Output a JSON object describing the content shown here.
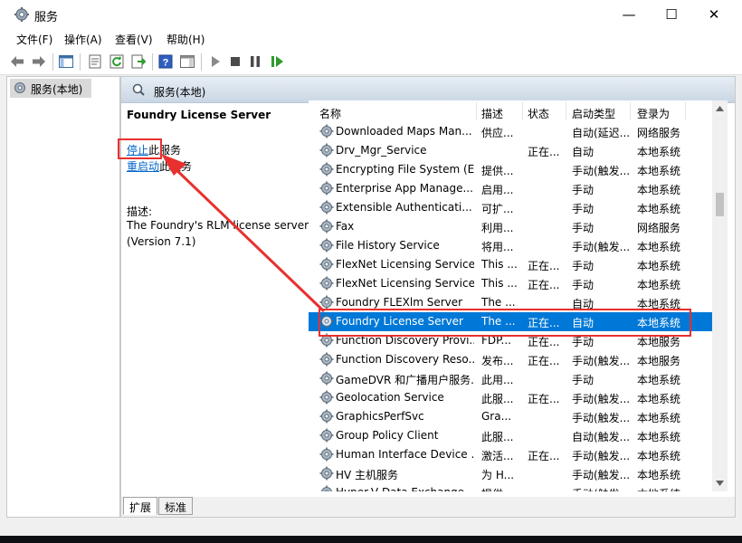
{
  "window": {
    "title": "服务",
    "minimize": "—",
    "maximize": "☐",
    "close": "✕"
  },
  "menu": [
    "文件(F)",
    "操作(A)",
    "查看(V)",
    "帮助(H)"
  ],
  "toolbar": {
    "icons": [
      "back-arrow-icon",
      "forward-arrow-icon",
      "show-hide-console-tree-icon",
      "properties-icon",
      "refresh-icon",
      "export-list-icon",
      "help-icon",
      "show-hide-action-pane-icon",
      "start-service-icon",
      "stop-service-icon",
      "pause-service-icon",
      "restart-service-icon"
    ]
  },
  "tree": {
    "items": [
      {
        "label": "服务(本地)"
      }
    ]
  },
  "main": {
    "header": "服务(本地)",
    "detail": {
      "service_name": "Foundry License Server",
      "stop_link": "停止",
      "stop_suffix": "此服务",
      "restart_link": "重启动",
      "restart_suffix": "此服务",
      "desc_label": "描述:",
      "desc_text_1": "The Foundry's RLM license server",
      "desc_text_2": "(Version 7.1)"
    },
    "columns": [
      "名称",
      "描述",
      "状态",
      "启动类型",
      "登录为"
    ],
    "rows": [
      {
        "name": "Downloaded Maps Man...",
        "desc": "供应...",
        "status": "",
        "startup": "自动(延迟...",
        "logon": "网络服务"
      },
      {
        "name": "Drv_Mgr_Service",
        "desc": "",
        "status": "正在...",
        "startup": "自动",
        "logon": "本地系统"
      },
      {
        "name": "Encrypting File System (E...",
        "desc": "提供...",
        "status": "",
        "startup": "手动(触发...",
        "logon": "本地系统"
      },
      {
        "name": "Enterprise App Manage...",
        "desc": "启用...",
        "status": "",
        "startup": "手动",
        "logon": "本地系统"
      },
      {
        "name": "Extensible Authenticati...",
        "desc": "可扩...",
        "status": "",
        "startup": "手动",
        "logon": "本地系统"
      },
      {
        "name": "Fax",
        "desc": "利用...",
        "status": "",
        "startup": "手动",
        "logon": "网络服务"
      },
      {
        "name": "File History Service",
        "desc": "将用...",
        "status": "",
        "startup": "手动(触发...",
        "logon": "本地系统"
      },
      {
        "name": "FlexNet Licensing Service",
        "desc": "This ...",
        "status": "正在...",
        "startup": "手动",
        "logon": "本地系统"
      },
      {
        "name": "FlexNet Licensing Service...",
        "desc": "This ...",
        "status": "正在...",
        "startup": "手动",
        "logon": "本地系统"
      },
      {
        "name": "Foundry FLEXlm Server",
        "desc": "The ...",
        "status": "",
        "startup": "自动",
        "logon": "本地系统"
      },
      {
        "name": "Foundry License Server",
        "desc": "The ...",
        "status": "正在...",
        "startup": "自动",
        "logon": "本地系统",
        "selected": true
      },
      {
        "name": "Function Discovery Provi...",
        "desc": "FDP...",
        "status": "正在...",
        "startup": "手动",
        "logon": "本地服务"
      },
      {
        "name": "Function Discovery Reso...",
        "desc": "发布...",
        "status": "正在...",
        "startup": "手动(触发...",
        "logon": "本地服务"
      },
      {
        "name": "GameDVR 和广播用户服务...",
        "desc": "此用...",
        "status": "",
        "startup": "手动",
        "logon": "本地系统"
      },
      {
        "name": "Geolocation Service",
        "desc": "此服...",
        "status": "正在...",
        "startup": "手动(触发...",
        "logon": "本地系统"
      },
      {
        "name": "GraphicsPerfSvc",
        "desc": "Gra...",
        "status": "",
        "startup": "手动(触发...",
        "logon": "本地系统"
      },
      {
        "name": "Group Policy Client",
        "desc": "此服...",
        "status": "",
        "startup": "自动(触发...",
        "logon": "本地系统"
      },
      {
        "name": "Human Interface Device ...",
        "desc": "激活...",
        "status": "正在...",
        "startup": "手动(触发...",
        "logon": "本地系统"
      },
      {
        "name": "HV 主机服务",
        "desc": "为 H...",
        "status": "",
        "startup": "手动(触发...",
        "logon": "本地系统"
      },
      {
        "name": "Hyper-V Data Exchange ...",
        "desc": "提供...",
        "status": "",
        "startup": "手动(触发...",
        "logon": "本地系统"
      }
    ]
  },
  "tabs": [
    "扩展",
    "标准"
  ],
  "colors": {
    "selection": "#0078d7",
    "annotation": "#e8302f",
    "link": "#0066cc"
  }
}
